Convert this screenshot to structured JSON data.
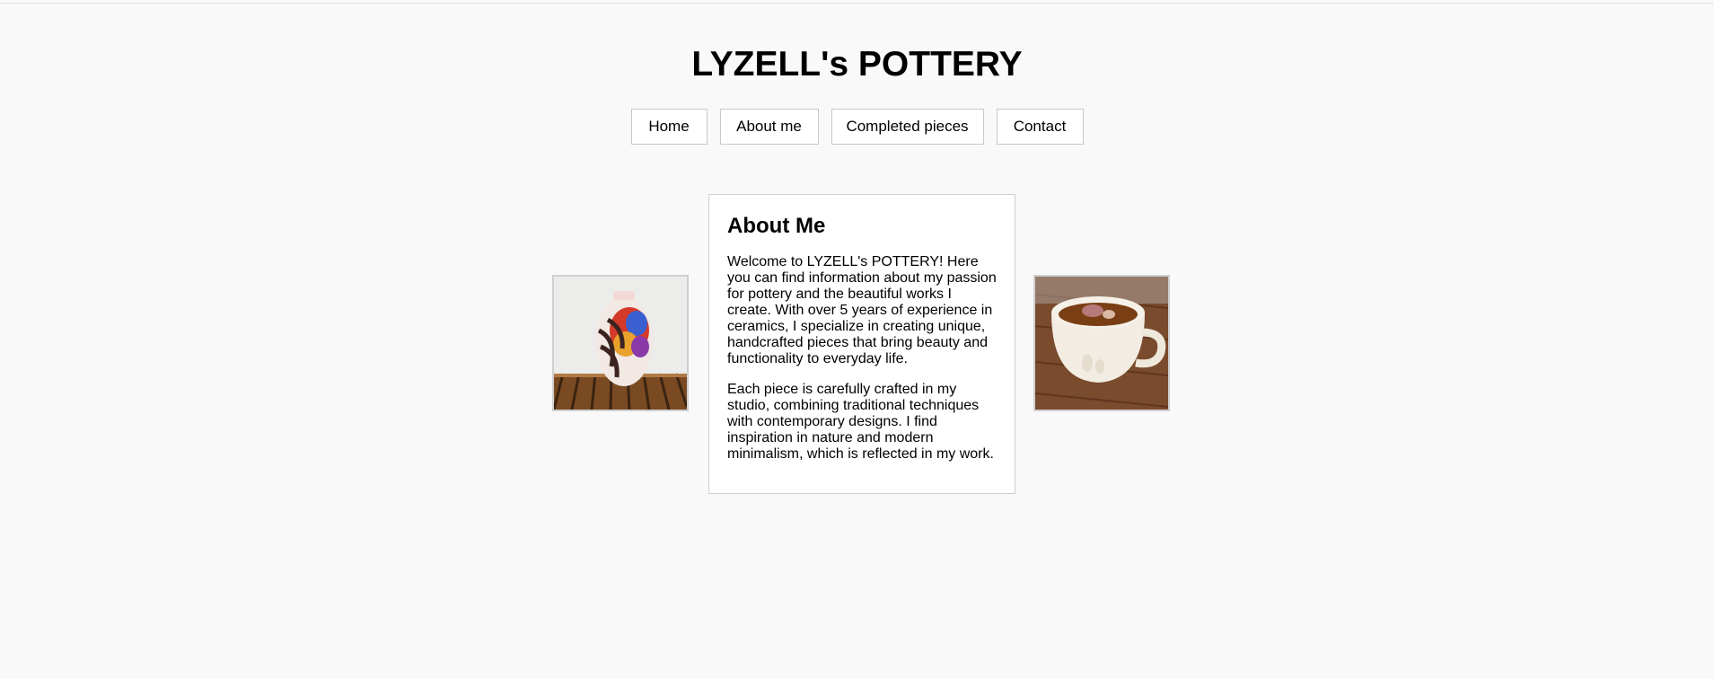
{
  "header": {
    "title": "LYZELL's POTTERY"
  },
  "nav": {
    "items": [
      {
        "label": "Home"
      },
      {
        "label": "About me"
      },
      {
        "label": "Completed pieces"
      },
      {
        "label": "Contact"
      }
    ]
  },
  "about": {
    "heading": "About Me",
    "paragraphs": [
      "Welcome to LYZELL's POTTERY! Here you can find information about my passion for pottery and the beautiful works I create. With over 5 years of experience in ceramics, I specialize in creating unique, handcrafted pieces that bring beauty and functionality to everyday life.",
      "Each piece is carefully crafted in my studio, combining traditional techniques with contemporary designs. I find inspiration in nature and modern minimalism, which is reflected in my work."
    ]
  },
  "images": {
    "left": {
      "subject": "raku-vase-photo"
    },
    "right": {
      "subject": "tea-cup-photo"
    }
  },
  "colors": {
    "background": "#f9f9f9",
    "card": "#ffffff",
    "border": "#cfcfcf",
    "text": "#000000"
  }
}
